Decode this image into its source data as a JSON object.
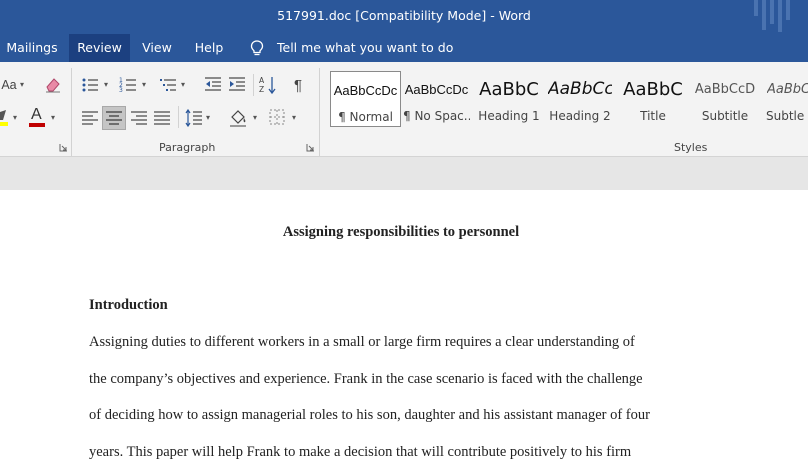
{
  "window": {
    "title": "517991.doc [Compatibility Mode]  -  Word"
  },
  "menu": {
    "tabs": [
      {
        "label": "Mailings"
      },
      {
        "label": "Review",
        "active": true
      },
      {
        "label": "View"
      },
      {
        "label": "Help"
      }
    ],
    "tell_me": "Tell me what you want to do"
  },
  "ribbon": {
    "font_group": {
      "change_case_label": "Aa"
    },
    "paragraph_group": {
      "label": "Paragraph",
      "pilcrow": "¶"
    },
    "styles_group": {
      "label": "Styles",
      "items": [
        {
          "preview": "AaBbCcDc",
          "label": "¶ Normal",
          "selected": true
        },
        {
          "preview": "AaBbCcDc",
          "label": "¶ No Spac..."
        },
        {
          "preview": "AaBbC",
          "label": "Heading 1"
        },
        {
          "preview": "AaBbCc",
          "label": "Heading 2"
        },
        {
          "preview": "AaBbC",
          "label": "Title"
        },
        {
          "preview": "AaBbCcD",
          "label": "Subtitle"
        },
        {
          "preview": "AaBbCc",
          "label": "Subtle E"
        }
      ]
    }
  },
  "document": {
    "title": "Assigning responsibilities to personnel",
    "heading": "Introduction",
    "lines": [
      "Assigning duties to different workers in a small or large firm requires a clear understanding of",
      "the company’s objectives and experience. Frank in the case scenario is faced with the challenge",
      "of deciding how to assign managerial roles to his son, daughter and his assistant manager of four",
      "years. This paper will help Frank to make a decision that will contribute positively to his firm"
    ]
  },
  "colors": {
    "title_bar": "#2b579a",
    "active_tab": "#1c4080",
    "ribbon": "#f3f3f3",
    "highlight_swatch": "#ffff00",
    "font_color_swatch": "#c00000"
  }
}
